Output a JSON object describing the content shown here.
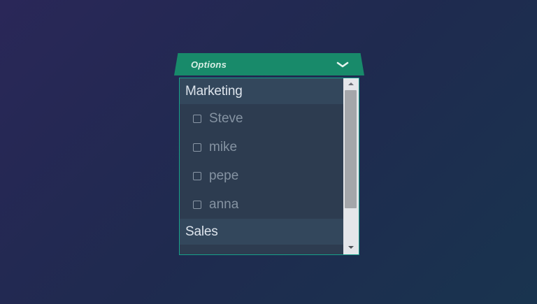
{
  "dropdown": {
    "label": "Options",
    "toggle_icon": "chevron-down-icon",
    "accent_color": "#188a6a",
    "expanded": true
  },
  "groups": [
    {
      "label": "Marketing",
      "items": [
        {
          "label": "Steve",
          "checked": false
        },
        {
          "label": "mike",
          "checked": false
        },
        {
          "label": "pepe",
          "checked": false
        },
        {
          "label": "anna",
          "checked": false
        }
      ]
    },
    {
      "label": "Sales",
      "items": []
    }
  ]
}
